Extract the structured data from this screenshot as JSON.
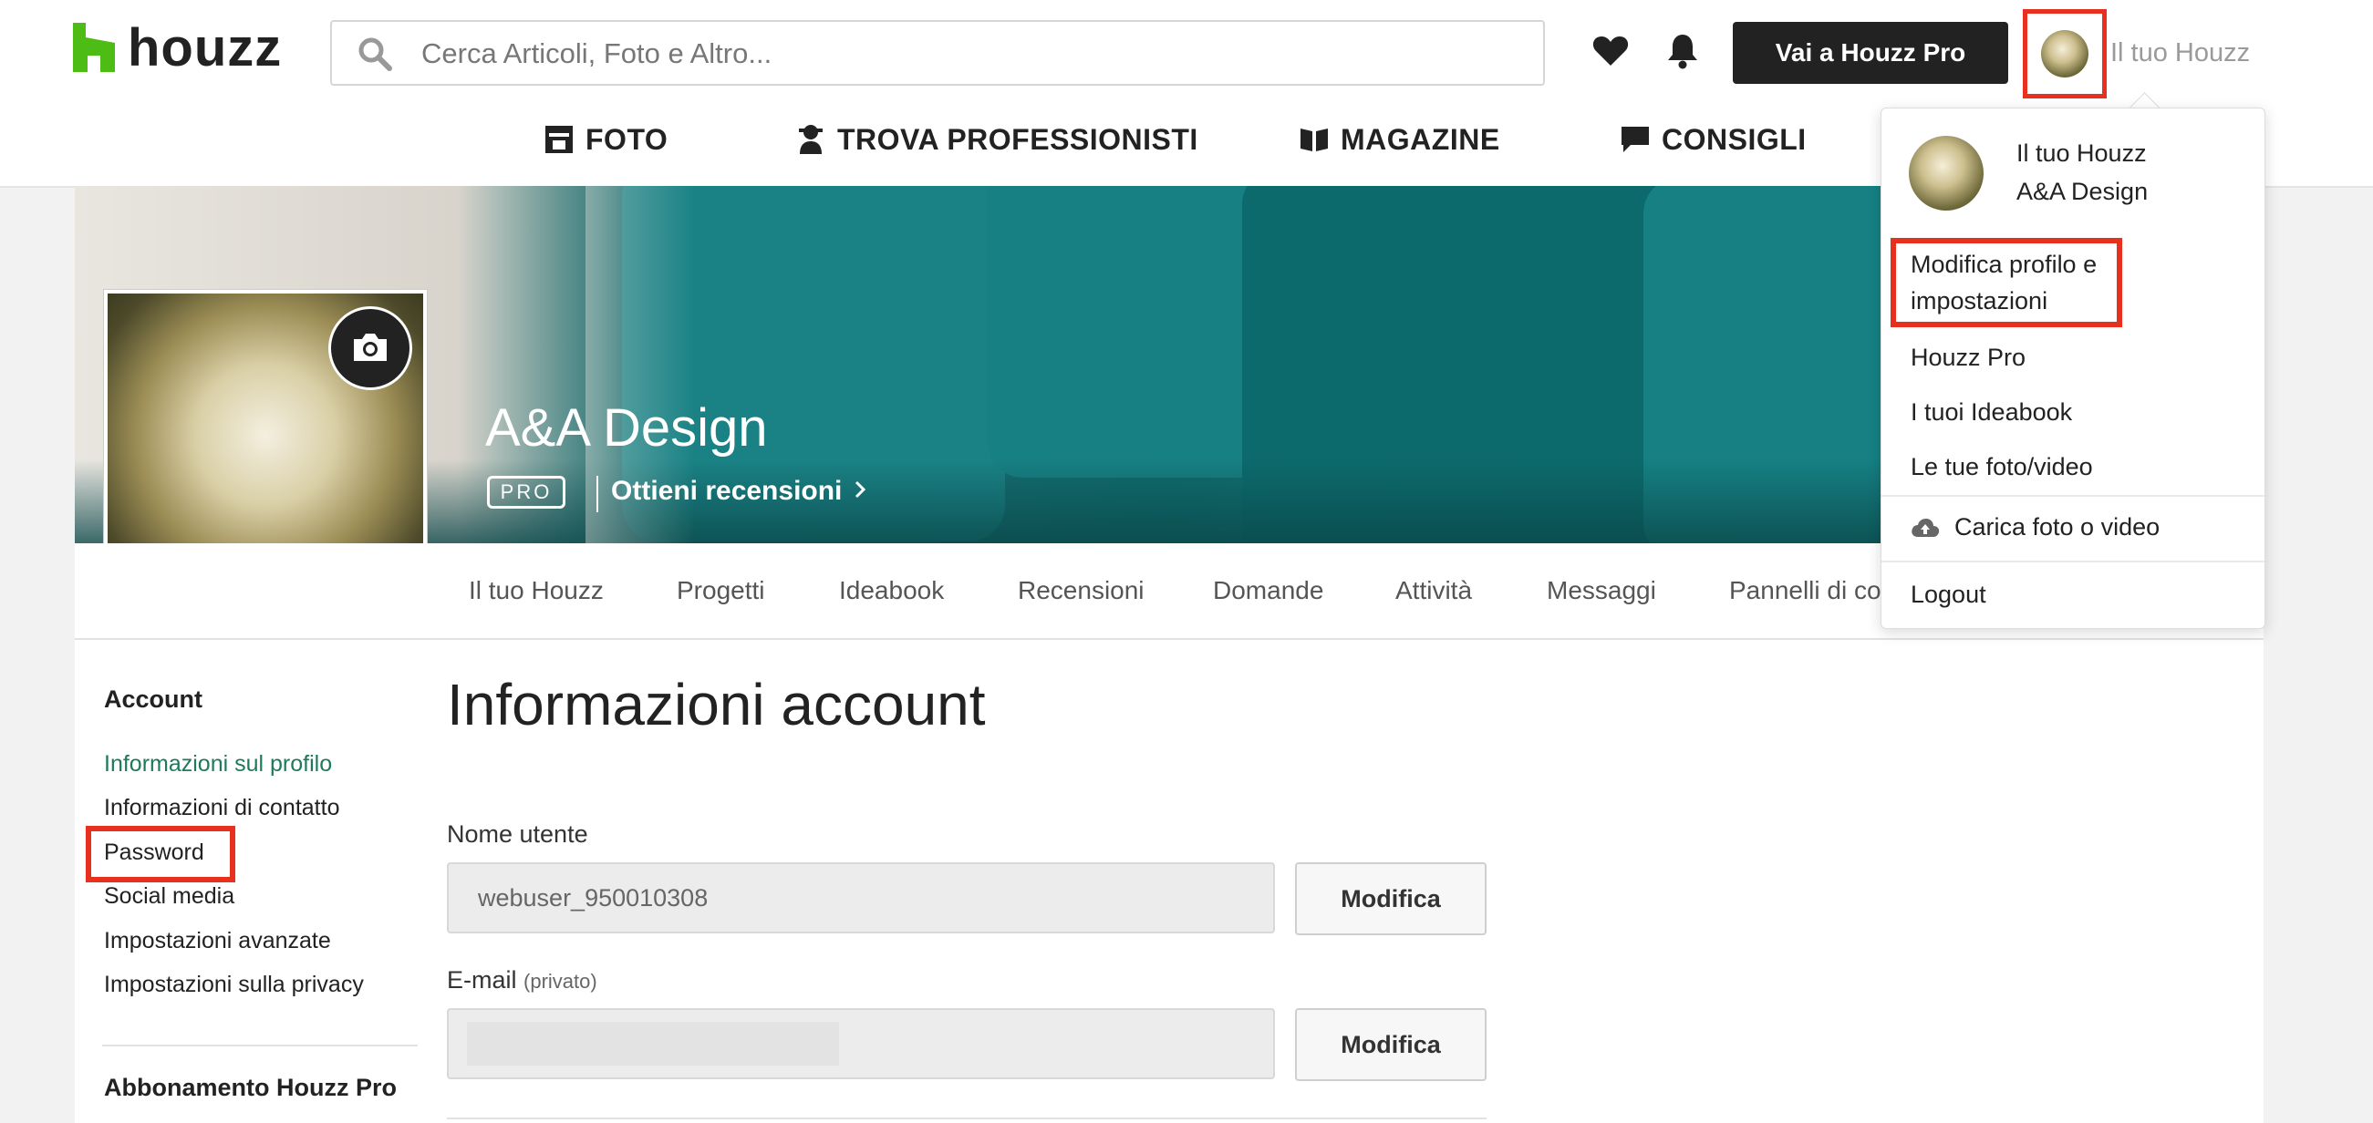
{
  "header": {
    "logo_text": "houzz",
    "search_placeholder": "Cerca Articoli, Foto e Altro...",
    "pro_button": "Vai a Houzz Pro",
    "user_label": "Il tuo Houzz"
  },
  "nav": {
    "items": [
      {
        "label": "FOTO",
        "icon": "photo-icon"
      },
      {
        "label": "TROVA PROFESSIONISTI",
        "icon": "professional-icon"
      },
      {
        "label": "MAGAZINE",
        "icon": "magazine-icon"
      },
      {
        "label": "CONSIGLI",
        "icon": "chat-bubble-icon"
      }
    ]
  },
  "profile": {
    "name": "A&A Design",
    "badge": "PRO",
    "reviews_link": "Ottieni recensioni"
  },
  "tabs": [
    "Il tuo Houzz",
    "Progetti",
    "Ideabook",
    "Recensioni",
    "Domande",
    "Attività",
    "Messaggi",
    "Pannelli di co"
  ],
  "sidebar": {
    "heading": "Account",
    "links": [
      "Informazioni sul profilo",
      "Informazioni di contatto",
      "Password",
      "Social media",
      "Impostazioni avanzate",
      "Impostazioni sulla privacy"
    ],
    "subscription_heading": "Abbonamento Houzz Pro"
  },
  "main": {
    "title": "Informazioni account",
    "username_label": "Nome utente",
    "username_value": "webuser_950010308",
    "email_label": "E-mail",
    "email_note": "(privato)",
    "edit_button": "Modifica"
  },
  "dropdown": {
    "header_title": "Il tuo Houzz",
    "header_name": "A&A Design",
    "items": [
      "Modifica profilo e",
      "impostazioni",
      "Houzz Pro",
      "I tuoi Ideabook",
      "Le tue foto/video",
      "Carica foto o video",
      "Logout"
    ]
  },
  "colors": {
    "accent_green": "#4dbc15",
    "active_link": "#1f7a5a",
    "highlight_red": "#e8301e"
  }
}
